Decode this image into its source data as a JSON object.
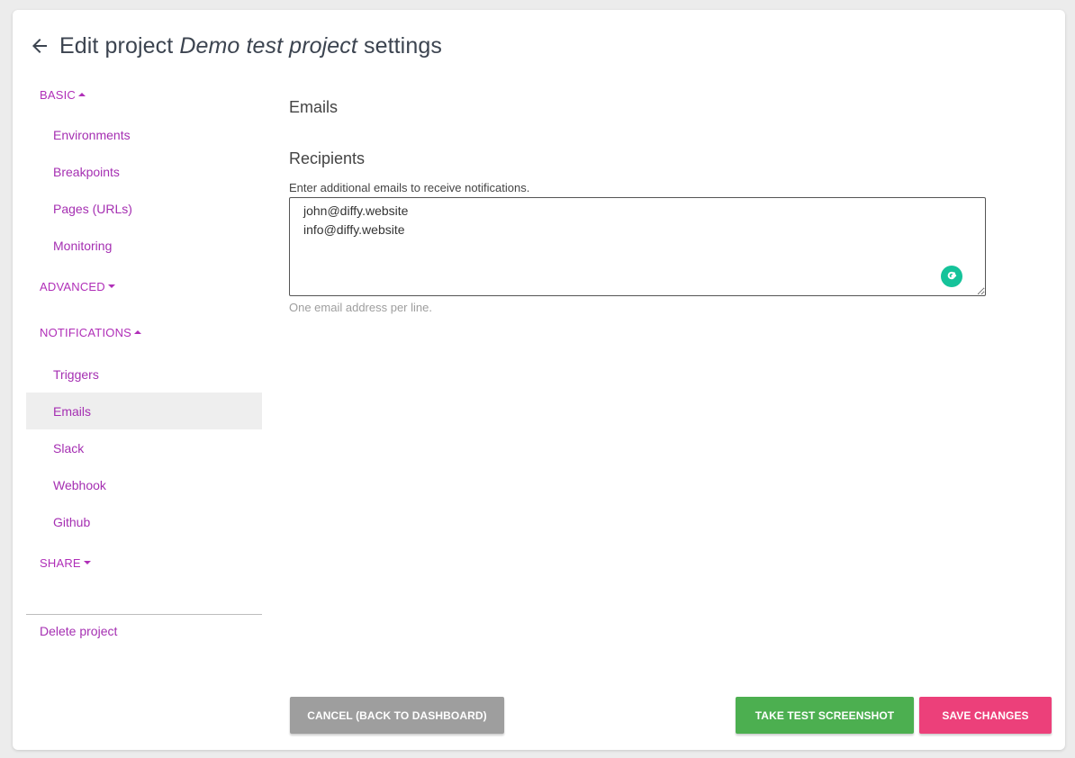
{
  "header": {
    "title_prefix": "Edit project",
    "project_name": "Demo test project",
    "title_suffix": "settings"
  },
  "sidebar": {
    "basic": {
      "label": "BASIC",
      "items": [
        "Environments",
        "Breakpoints",
        "Pages (URLs)",
        "Monitoring"
      ]
    },
    "advanced": {
      "label": "ADVANCED"
    },
    "notifications": {
      "label": "NOTIFICATIONS",
      "items": [
        "Triggers",
        "Emails",
        "Slack",
        "Webhook",
        "Github"
      ]
    },
    "share": {
      "label": "SHARE"
    },
    "delete_label": "Delete project"
  },
  "main": {
    "title": "Emails",
    "recipients_title": "Recipients",
    "field_label": "Enter additional emails to receive notifications.",
    "emails_value": "john@diffy.website\ninfo@diffy.website",
    "helper": "One email address per line."
  },
  "buttons": {
    "cancel": "CANCEL (BACK TO DASHBOARD)",
    "test": "TAKE TEST SCREENSHOT",
    "save": "SAVE CHANGES"
  },
  "colors": {
    "accent": "#a52fb2",
    "cancel": "#9e9e9e",
    "test": "#4caf50",
    "save": "#ec407a",
    "grammarly": "#15c39a"
  }
}
